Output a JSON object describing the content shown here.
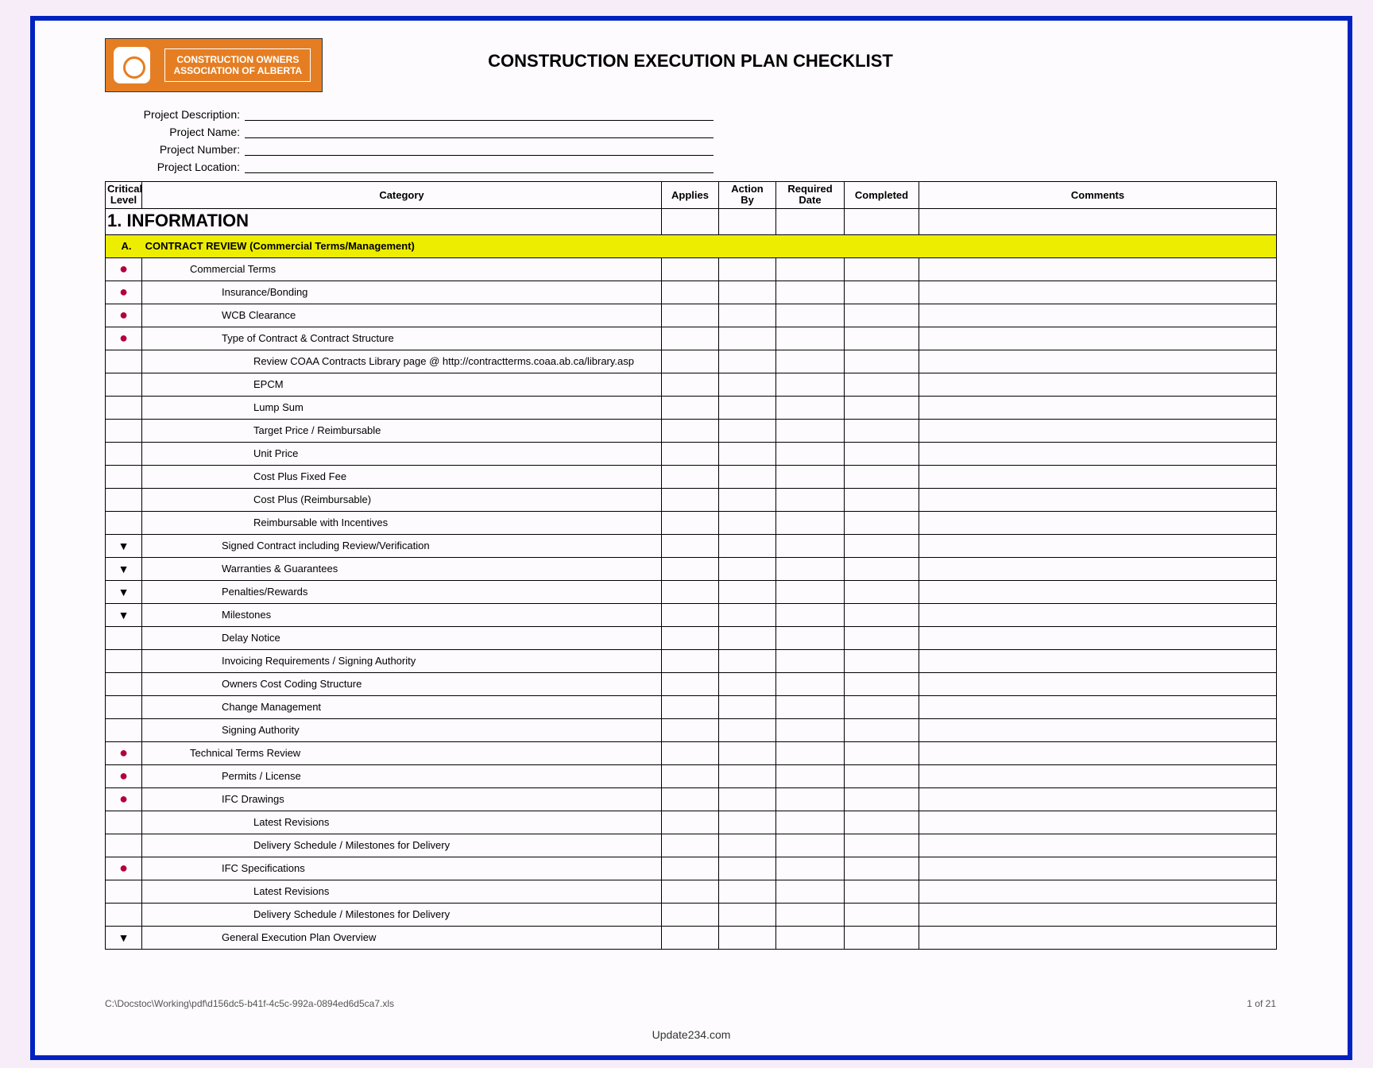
{
  "header": {
    "org_line1": "CONSTRUCTION OWNERS",
    "org_line2": "ASSOCIATION OF ALBERTA",
    "title": "CONSTRUCTION EXECUTION PLAN CHECKLIST"
  },
  "meta": {
    "project_description_label": "Project Description:",
    "project_name_label": "Project Name:",
    "project_number_label": "Project Number:",
    "project_location_label": "Project Location:"
  },
  "columns": {
    "critical": "Critical Level",
    "category": "Category",
    "applies": "Applies",
    "action_by": "Action By",
    "required_date": "Required Date",
    "completed": "Completed",
    "comments": "Comments"
  },
  "section": {
    "number_title": "1. INFORMATION",
    "sub_letter": "A.",
    "sub_title": "CONTRACT REVIEW (Commercial Terms/Management)"
  },
  "rows": [
    {
      "mark": "dot",
      "indent": 1,
      "text": "Commercial Terms"
    },
    {
      "mark": "dot",
      "indent": 2,
      "text": "Insurance/Bonding"
    },
    {
      "mark": "dot",
      "indent": 2,
      "text": "WCB Clearance"
    },
    {
      "mark": "dot",
      "indent": 2,
      "text": "Type of Contract & Contract Structure"
    },
    {
      "mark": "",
      "indent": 3,
      "text": "Review COAA Contracts Library page @ http://contractterms.coaa.ab.ca/library.asp"
    },
    {
      "mark": "",
      "indent": 3,
      "text": "EPCM"
    },
    {
      "mark": "",
      "indent": 3,
      "text": "Lump Sum"
    },
    {
      "mark": "",
      "indent": 3,
      "text": "Target Price / Reimbursable"
    },
    {
      "mark": "",
      "indent": 3,
      "text": "Unit Price"
    },
    {
      "mark": "",
      "indent": 3,
      "text": "Cost Plus Fixed Fee"
    },
    {
      "mark": "",
      "indent": 3,
      "text": "Cost Plus (Reimbursable)"
    },
    {
      "mark": "",
      "indent": 3,
      "text": "Reimbursable with Incentives"
    },
    {
      "mark": "tri",
      "indent": 2,
      "text": "Signed Contract including Review/Verification"
    },
    {
      "mark": "tri",
      "indent": 2,
      "text": "Warranties & Guarantees"
    },
    {
      "mark": "tri",
      "indent": 2,
      "text": "Penalties/Rewards"
    },
    {
      "mark": "tri",
      "indent": 2,
      "text": "Milestones"
    },
    {
      "mark": "",
      "indent": 2,
      "text": "Delay Notice"
    },
    {
      "mark": "",
      "indent": 2,
      "text": "Invoicing Requirements / Signing Authority"
    },
    {
      "mark": "",
      "indent": 2,
      "text": "Owners Cost Coding Structure"
    },
    {
      "mark": "",
      "indent": 2,
      "text": "Change Management"
    },
    {
      "mark": "",
      "indent": 2,
      "text": "Signing Authority"
    },
    {
      "mark": "dot",
      "indent": 1,
      "text": "Technical Terms Review"
    },
    {
      "mark": "dot",
      "indent": 2,
      "text": "Permits / License"
    },
    {
      "mark": "dot",
      "indent": 2,
      "text": "IFC Drawings"
    },
    {
      "mark": "",
      "indent": 3,
      "text": "Latest Revisions"
    },
    {
      "mark": "",
      "indent": 3,
      "text": "Delivery Schedule / Milestones for Delivery"
    },
    {
      "mark": "dot",
      "indent": 2,
      "text": "IFC Specifications"
    },
    {
      "mark": "",
      "indent": 3,
      "text": "Latest Revisions"
    },
    {
      "mark": "",
      "indent": 3,
      "text": "Delivery Schedule / Milestones for Delivery"
    },
    {
      "mark": "tri",
      "indent": 2,
      "text": "General Execution Plan Overview"
    }
  ],
  "footer": {
    "path": "C:\\Docstoc\\Working\\pdf\\d156dc5-b41f-4c5c-992a-0894ed6d5ca7.xls",
    "page": "1 of 21",
    "watermark": "Update234.com"
  }
}
